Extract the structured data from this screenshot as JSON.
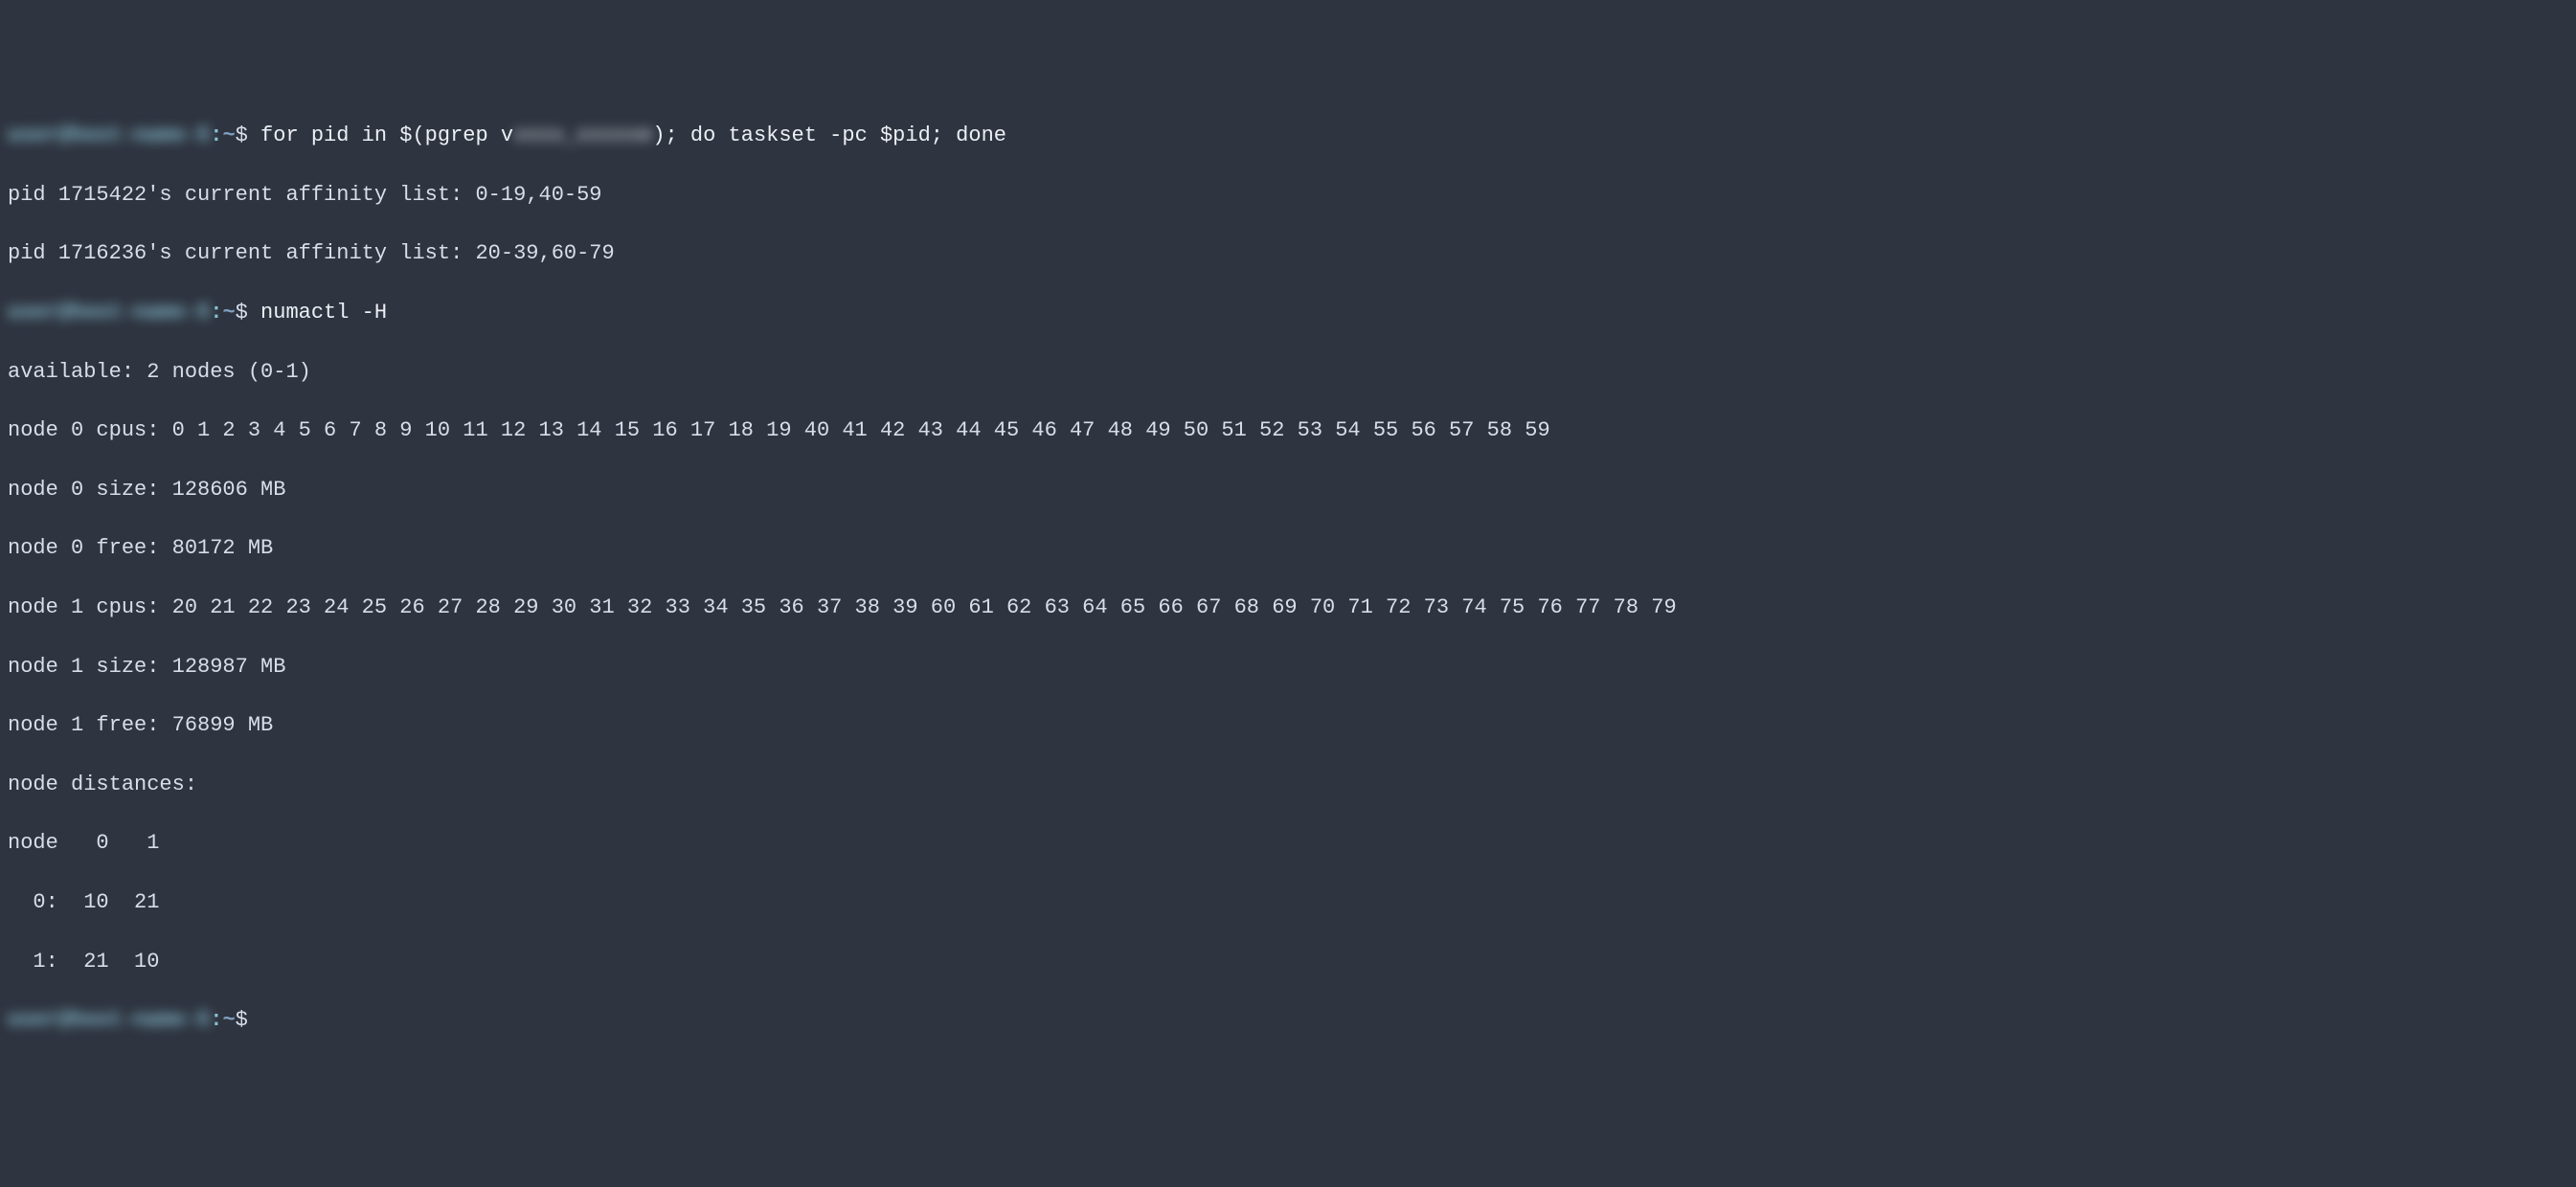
{
  "prompt1": {
    "host_redacted": "user@host-name-5",
    "sep": ":",
    "path": "~",
    "dollar": "$ "
  },
  "cmd1_part1": "for pid in $(pgrep v",
  "cmd1_redacted": "xxxx_xxxxxe",
  "cmd1_part2": "); do taskset -pc $pid; done",
  "out1": "pid 1715422's current affinity list: 0-19,40-59",
  "out2": "pid 1716236's current affinity list: 20-39,60-79",
  "prompt2": {
    "host_redacted": "user@host-name-5",
    "sep": ":",
    "path": "~",
    "dollar": "$ "
  },
  "cmd2": "numactl -H",
  "out3": "available: 2 nodes (0-1)",
  "out4": "node 0 cpus: 0 1 2 3 4 5 6 7 8 9 10 11 12 13 14 15 16 17 18 19 40 41 42 43 44 45 46 47 48 49 50 51 52 53 54 55 56 57 58 59",
  "out5": "node 0 size: 128606 MB",
  "out6": "node 0 free: 80172 MB",
  "out7": "node 1 cpus: 20 21 22 23 24 25 26 27 28 29 30 31 32 33 34 35 36 37 38 39 60 61 62 63 64 65 66 67 68 69 70 71 72 73 74 75 76 77 78 79",
  "out8": "node 1 size: 128987 MB",
  "out9": "node 1 free: 76899 MB",
  "out10": "node distances:",
  "out11": "node   0   1 ",
  "out12": "  0:  10  21 ",
  "out13": "  1:  21  10 ",
  "prompt3": {
    "host_redacted": "user@host-name-5",
    "sep": ":",
    "path": "~",
    "dollar": "$ "
  }
}
